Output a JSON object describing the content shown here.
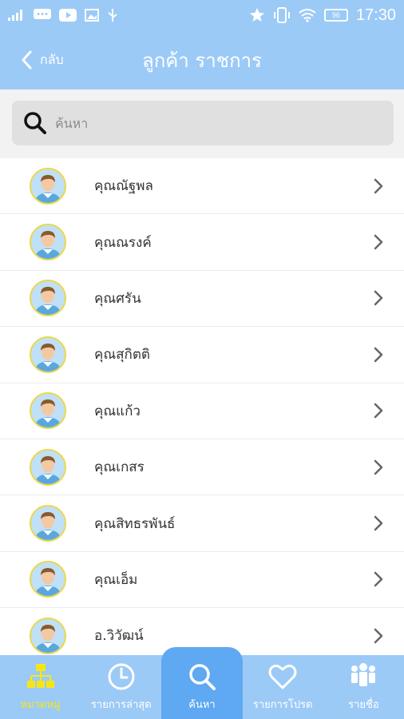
{
  "status_bar": {
    "time": "17:30",
    "battery": "96"
  },
  "header": {
    "back_label": "กลับ",
    "title": "ลูกค้า ราชการ"
  },
  "search": {
    "placeholder": "ค้นหา"
  },
  "customers": [
    "คุณณัฐพล",
    "คุณณรงค์",
    "คุณศรัน",
    "คุณสุกิตติ",
    "คุณแก้ว",
    "คุณเกสร",
    "คุณสิทธรพันธ์",
    "คุณเอ็ม",
    "อ.วิวัฒน์"
  ],
  "tabs": [
    {
      "label": "หมวดหมู่",
      "icon": "category-icon"
    },
    {
      "label": "รายการล่าสุด",
      "icon": "clock-icon"
    },
    {
      "label": "ค้นหา",
      "icon": "search-icon"
    },
    {
      "label": "รายการโปรด",
      "icon": "heart-icon"
    },
    {
      "label": "รายชื่อ",
      "icon": "people-icon"
    }
  ],
  "colors": {
    "header": "#9ccaf7",
    "active_tab": "#5fa8f2",
    "active_label": "#f5e61a"
  }
}
